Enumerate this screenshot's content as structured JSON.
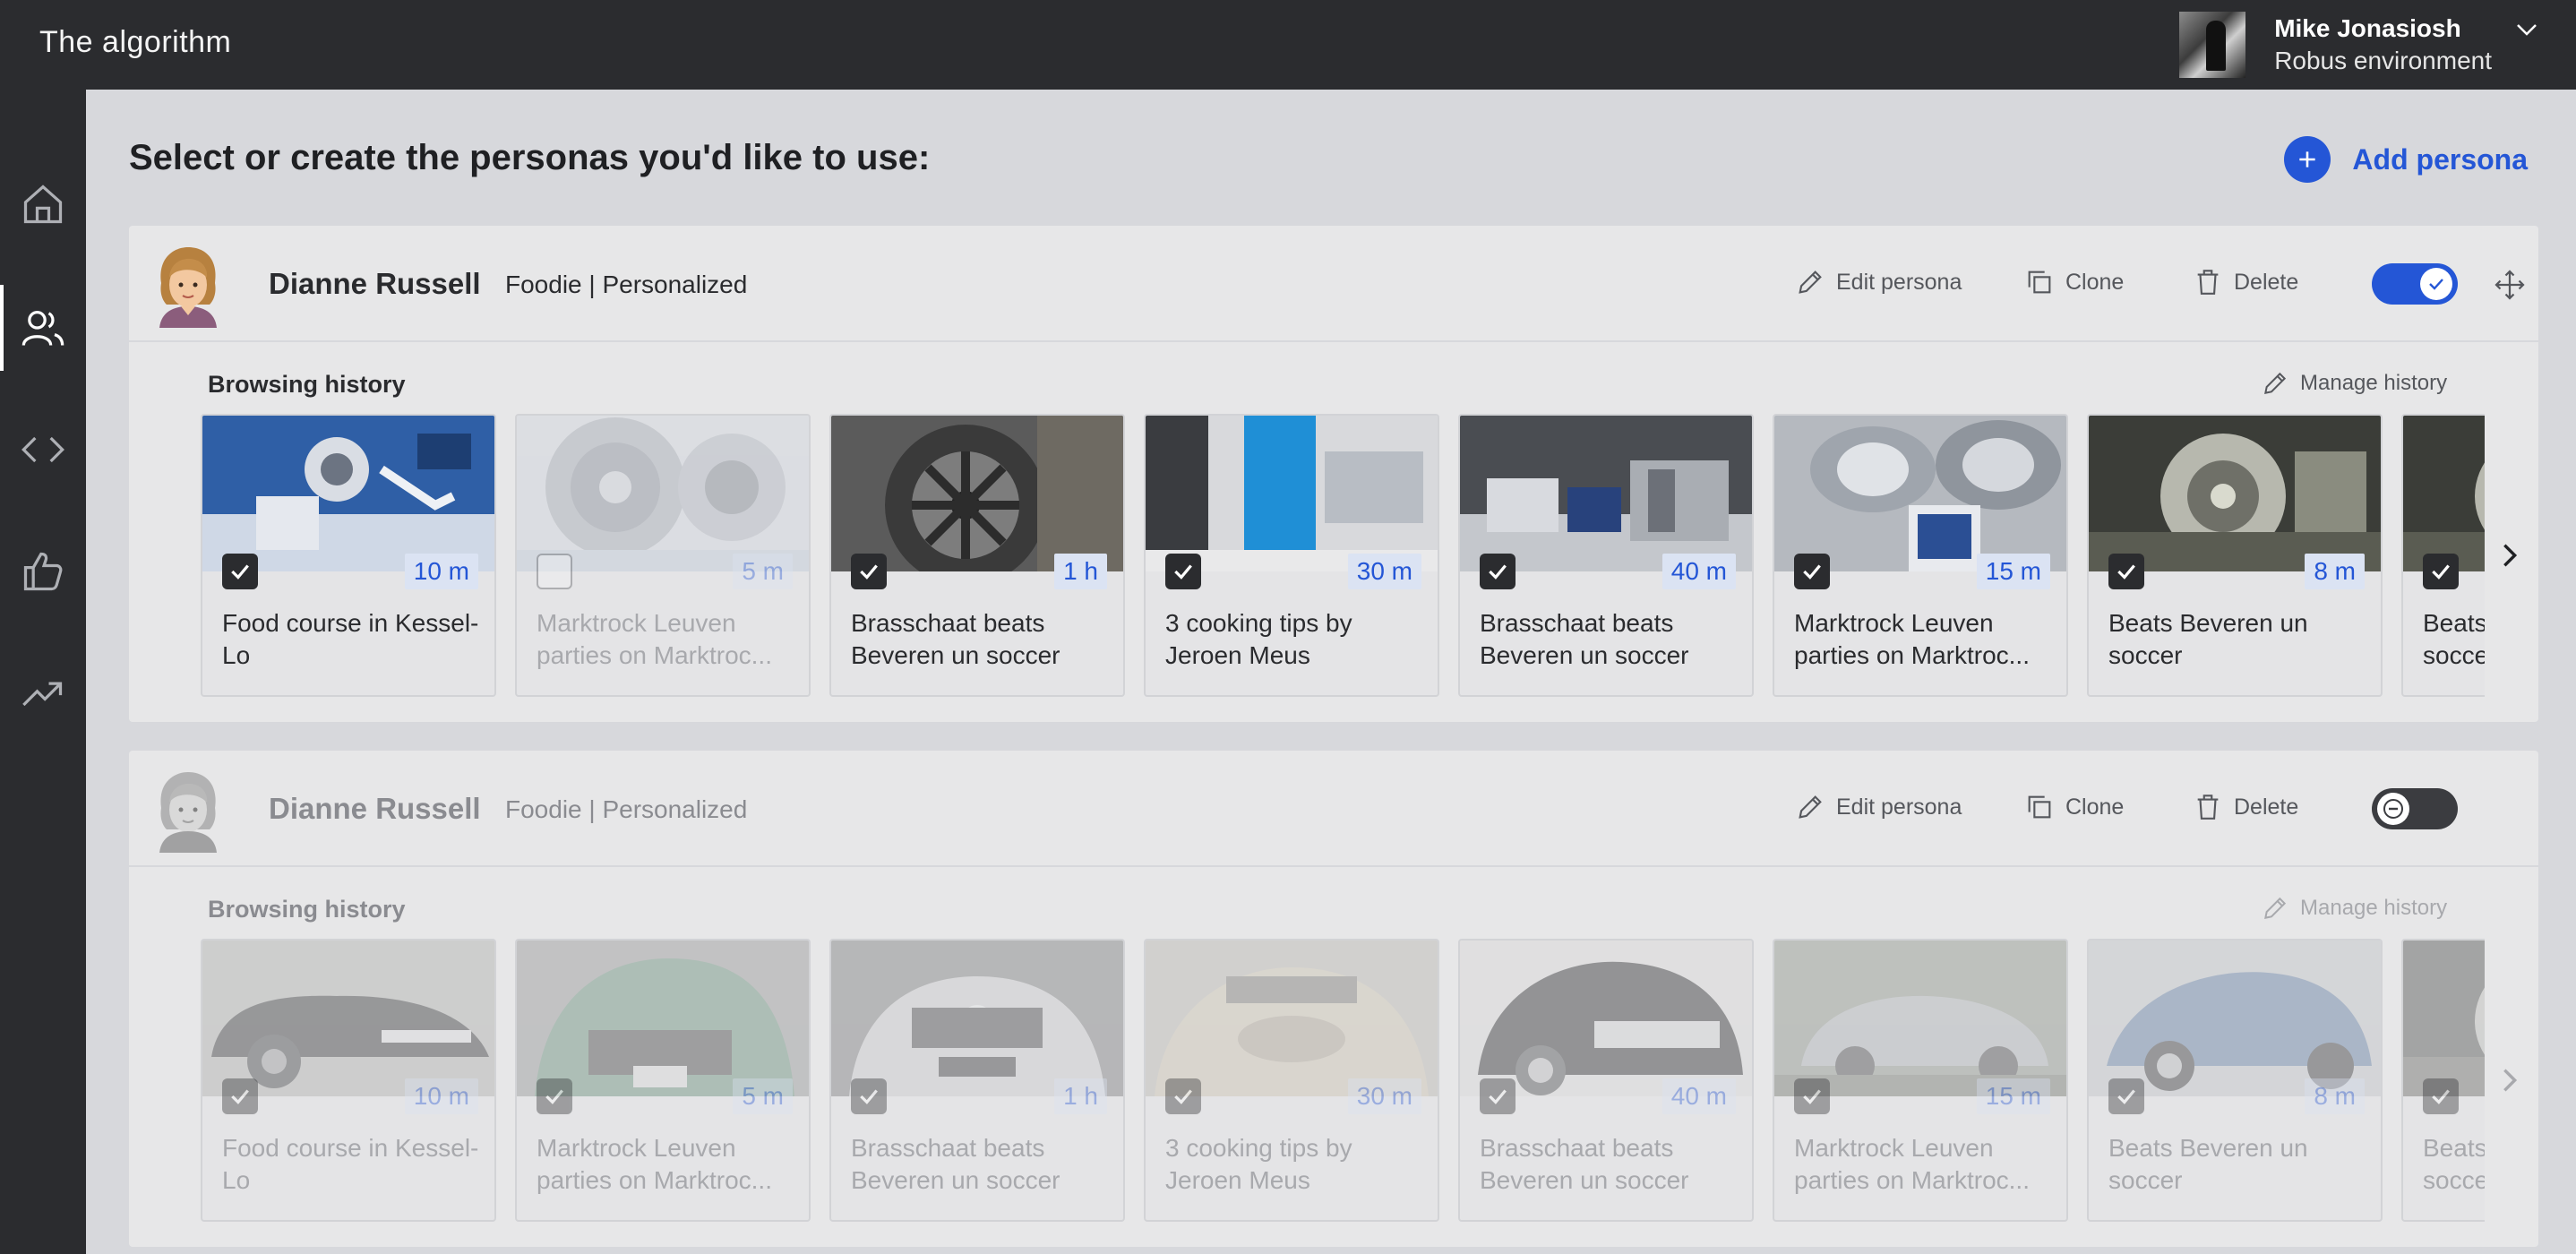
{
  "app": {
    "title": "The algorithm"
  },
  "user": {
    "name": "Mike Jonasiosh",
    "environment": "Robus environment"
  },
  "sidebar": {
    "items": [
      {
        "name": "home",
        "icon": "home-icon",
        "active": false
      },
      {
        "name": "personas",
        "icon": "users-icon",
        "active": true
      },
      {
        "name": "code",
        "icon": "code-icon",
        "active": false
      },
      {
        "name": "likes",
        "icon": "thumbs-up-icon",
        "active": false
      },
      {
        "name": "trends",
        "icon": "trending-up-icon",
        "active": false
      }
    ]
  },
  "page": {
    "heading": "Select or create the personas you'd like to use:",
    "add_persona_label": "Add persona"
  },
  "actions": {
    "edit": "Edit persona",
    "clone": "Clone",
    "delete": "Delete",
    "manage_history": "Manage history",
    "browsing_history": "Browsing history"
  },
  "personas": [
    {
      "name": "Dianne Russell",
      "tags": "Foodie | Personalized",
      "enabled": true,
      "history": [
        {
          "title": "Food course in Kessel-Lo",
          "duration": "10 m",
          "checked": true,
          "image": "robotics-lab"
        },
        {
          "title": "Marktrock Leuven parties on Marktroc...",
          "duration": "5 m",
          "checked": false,
          "image": "jet-turbine"
        },
        {
          "title": "Brasschaat beats Beveren un soccer",
          "duration": "1 h",
          "checked": true,
          "image": "flywheel-machine"
        },
        {
          "title": "3 cooking tips by Jeroen Meus",
          "duration": "30 m",
          "checked": true,
          "image": "blue-lab"
        },
        {
          "title": "Brasschaat beats Beveren un soccer",
          "duration": "40 m",
          "checked": true,
          "image": "lab-equipment"
        },
        {
          "title": "Marktrock Leuven parties on Marktroc...",
          "duration": "15 m",
          "checked": true,
          "image": "vacuum-chambers"
        },
        {
          "title": "Beats Beveren un soccer",
          "duration": "8 m",
          "checked": true,
          "image": "vacuum-apparatus"
        },
        {
          "title": "Beats Beveren un soccer",
          "duration": "",
          "checked": true,
          "image": "vacuum-apparatus"
        }
      ]
    },
    {
      "name": "Dianne Russell",
      "tags": "Foodie | Personalized",
      "enabled": false,
      "history": [
        {
          "title": "Food course in Kessel-Lo",
          "duration": "10 m",
          "checked": true,
          "image": "black-audi"
        },
        {
          "title": "Marktrock Leuven parties on Marktroc...",
          "duration": "5 m",
          "checked": true,
          "image": "green-toyota"
        },
        {
          "title": "Brasschaat beats Beveren un soccer",
          "duration": "1 h",
          "checked": true,
          "image": "silver-mercedes"
        },
        {
          "title": "3 cooking tips by Jeroen Meus",
          "duration": "30 m",
          "checked": true,
          "image": "gold-toyota"
        },
        {
          "title": "Brasschaat beats Beveren un soccer",
          "duration": "40 m",
          "checked": true,
          "image": "black-mercedes"
        },
        {
          "title": "Marktrock Leuven parties on Marktroc...",
          "duration": "15 m",
          "checked": true,
          "image": "grey-sedan"
        },
        {
          "title": "Beats Beveren un soccer",
          "duration": "8 m",
          "checked": true,
          "image": "blue-porsche"
        },
        {
          "title": "Beats Beveren un soccer",
          "duration": "",
          "checked": true,
          "image": "vacuum-apparatus"
        }
      ]
    }
  ],
  "colors": {
    "accent": "#2456d6",
    "sidebar": "#2b2c2f",
    "background": "#d7d8dc",
    "card": "#e7e7e8"
  }
}
